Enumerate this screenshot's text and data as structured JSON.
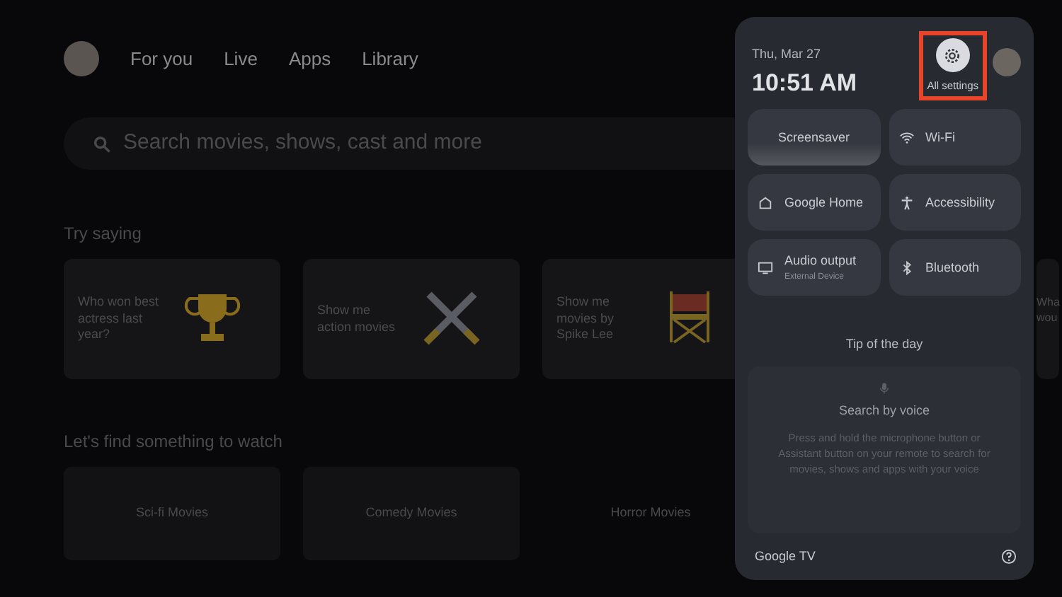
{
  "nav": {
    "tabs": [
      {
        "label": "For you",
        "selected": false
      },
      {
        "label": "Live",
        "selected": false
      },
      {
        "label": "Apps",
        "selected": false
      },
      {
        "label": "Library",
        "selected": false
      }
    ]
  },
  "search": {
    "placeholder": "Search movies, shows, cast and more"
  },
  "try_saying": {
    "title": "Try saying",
    "cards": [
      {
        "text": "Who won best actress last year?",
        "kind": "trophy"
      },
      {
        "text": "Show me action movies",
        "kind": "swords"
      },
      {
        "text": "Show me movies by Spike Lee",
        "kind": "chair"
      },
      {
        "text": "Wha wou",
        "kind": "partial"
      }
    ]
  },
  "watch": {
    "title": "Let's find something to watch",
    "tiles": [
      {
        "label": "Sci-fi Movies",
        "kind": "photo"
      },
      {
        "label": "Comedy Movies",
        "kind": "photo"
      },
      {
        "label": "Horror Movies",
        "kind": "plain"
      }
    ]
  },
  "panel": {
    "date": "Thu, Mar 27",
    "time": "10:51 AM",
    "settings": {
      "label": "All settings",
      "highlighted": true
    },
    "tiles": [
      {
        "label": "Screensaver",
        "kind": "screensaver"
      },
      {
        "label": "Wi-Fi",
        "kind": "wifi"
      },
      {
        "label": "Google Home",
        "kind": "home"
      },
      {
        "label": "Accessibility",
        "kind": "accessibility"
      },
      {
        "label": "Audio output",
        "sub": "External Device",
        "kind": "tv"
      },
      {
        "label": "Bluetooth",
        "kind": "bluetooth"
      }
    ],
    "tip": {
      "title": "Tip of the day",
      "heading": "Search by voice",
      "body": "Press and hold the microphone button or Assistant button on your remote to search for movies, shows and apps with your voice"
    },
    "footer": "Google TV"
  }
}
